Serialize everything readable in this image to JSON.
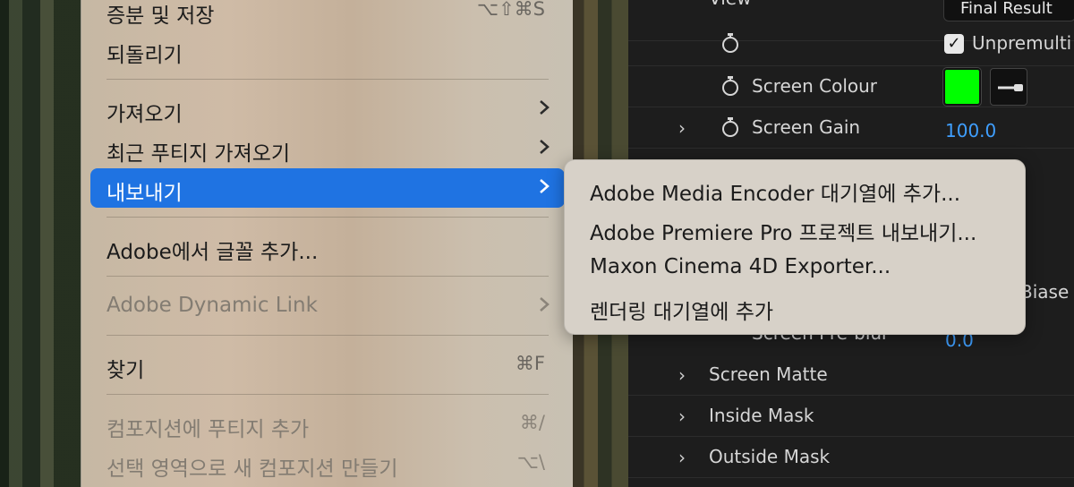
{
  "main_menu": {
    "items": [
      {
        "label": "증분 및 저장",
        "shortcut": "⌥⇧⌘S",
        "enabled": true
      },
      {
        "label": "되돌리기",
        "shortcut": "",
        "enabled": true
      },
      {
        "label": "가져오기",
        "has_submenu": true,
        "enabled": true
      },
      {
        "label": "최근 푸티지 가져오기",
        "has_submenu": true,
        "enabled": true
      },
      {
        "label": "내보내기",
        "has_submenu": true,
        "enabled": true,
        "selected": true
      },
      {
        "label": "Adobe에서 글꼴 추가...",
        "enabled": true
      },
      {
        "label": "Adobe Dynamic Link",
        "has_submenu": true,
        "enabled": false
      },
      {
        "label": "찾기",
        "shortcut": "⌘F",
        "enabled": true
      },
      {
        "label": "컴포지션에 푸티지 추가",
        "shortcut": "⌘/",
        "enabled": false
      },
      {
        "label": "선택 영역으로 새 컴포지션 만들기",
        "shortcut": "⌥\\",
        "enabled": false
      }
    ]
  },
  "export_submenu": {
    "items": [
      "Adobe Media Encoder 대기열에 추가...",
      "Adobe Premiere Pro 프로젝트 내보내기...",
      "Maxon Cinema 4D Exporter...",
      "렌더링 대기열에 추가"
    ]
  },
  "effect_panel": {
    "view_label": "View",
    "view_value": "Final Result",
    "unpremultiply_label": "Unpremulti",
    "unpremultiply_checked": true,
    "screen_colour_label": "Screen Colour",
    "screen_colour": "#00ff00",
    "screen_gain_label": "Screen Gain",
    "screen_gain_value": "100.0",
    "biase_partial": "Biase",
    "screen_preblur_label": "Screen Pre-blur",
    "screen_preblur_value": "0.0",
    "groups": [
      "Screen Matte",
      "Inside Mask",
      "Outside Mask"
    ]
  },
  "colors": {
    "selection_blue": "#1f73e2",
    "value_blue": "#3f9fff",
    "panel_bg": "#1d1d1d"
  }
}
